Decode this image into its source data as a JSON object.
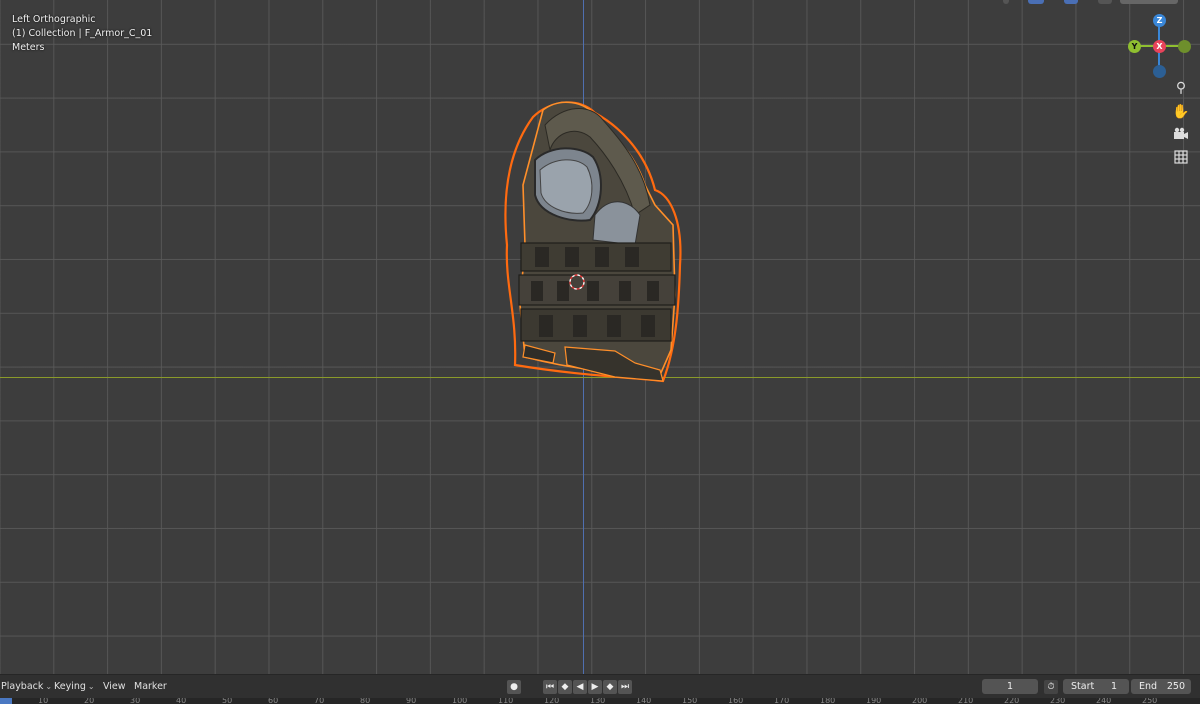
{
  "viewport": {
    "view_name": "Left Orthographic",
    "collection": "(1) Collection | F_Armor_C_01",
    "units": "Meters"
  },
  "gizmo": {
    "z": "Z",
    "y": "Y",
    "x": "X"
  },
  "nav_icons": [
    "zoom-icon",
    "hand-pan-icon",
    "camera-icon",
    "grid-icon"
  ],
  "timeline": {
    "playback": "Playback",
    "keying": "Keying",
    "view": "View",
    "marker": "Marker",
    "current_frame": "1",
    "start_label": "Start",
    "start_value": "1",
    "end_label": "End",
    "end_value": "250"
  },
  "ruler_ticks": [
    "10",
    "20",
    "30",
    "40",
    "50",
    "60",
    "70",
    "80",
    "90",
    "100",
    "110",
    "120",
    "130",
    "140",
    "150",
    "160",
    "170",
    "180",
    "190",
    "200",
    "210",
    "220",
    "230",
    "240",
    "250"
  ],
  "colors": {
    "outline": "#ff7a1a",
    "x_axis": "#e8435a",
    "y_axis": "#8fbf30",
    "z_axis": "#3a87d8"
  }
}
